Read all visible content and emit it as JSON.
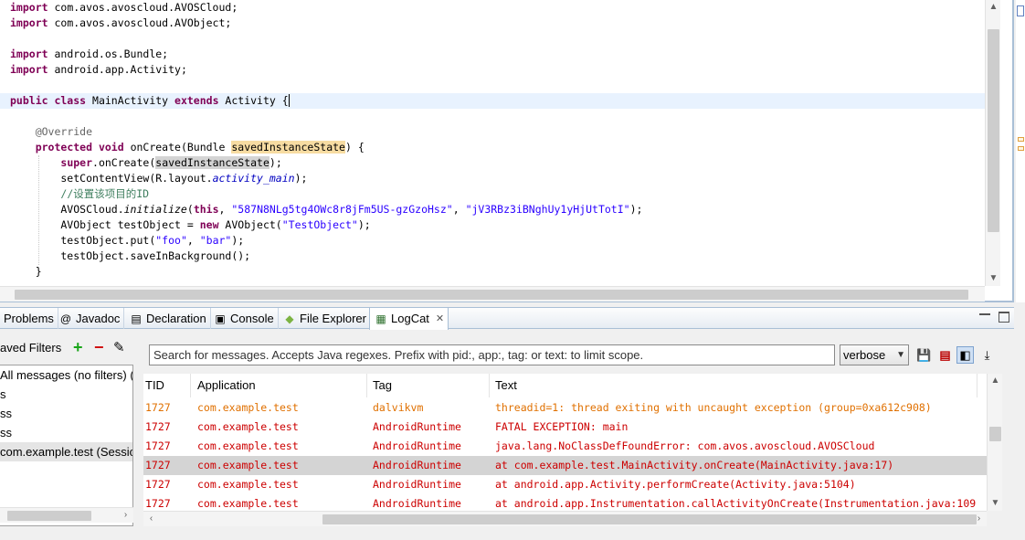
{
  "editor": {
    "lines": [
      {
        "html": "<span class=\"kw\">import</span> com.avos.avoscloud.AVOSCloud;"
      },
      {
        "html": "<span class=\"kw\">import</span> com.avos.avoscloud.AVObject;"
      },
      {
        "html": ""
      },
      {
        "html": "<span class=\"kw\">import</span> android.os.Bundle;"
      },
      {
        "html": "<span class=\"kw\">import</span> android.app.Activity;"
      },
      {
        "html": ""
      },
      {
        "html": "<span class=\"kw\">public class</span> MainActivity <span class=\"kw\">extends</span> Activity {<span class=\"caret\"></span>",
        "current": true
      },
      {
        "html": ""
      },
      {
        "html": "    <span class=\"ann\">@Override</span>"
      },
      {
        "html": "    <span class=\"kw\">protected void</span> onCreate(Bundle <span class=\"hl\">savedInstanceState</span>) {"
      },
      {
        "html": "        <span class=\"kw\">super</span>.onCreate(<span class=\"hl2\">savedInstanceState</span>);"
      },
      {
        "html": "        setContentView(R.layout.<span class=\"it\">activity_main</span>);"
      },
      {
        "html": "        <span class=\"cmt\">//设置该项目的ID</span>"
      },
      {
        "html": "        AVOSCloud.<span class=\"ital\">initialize</span>(<span class=\"kw\">this</span>, <span class=\"str\">\"587N8NLg5tg4OWc8r8jFm5US-gzGzoHsz\"</span>, <span class=\"str\">\"jV3RBz3iBNghUy1yHjUtTotI\"</span>);"
      },
      {
        "html": "        AVObject testObject = <span class=\"kw\">new</span> AVObject(<span class=\"str\">\"TestObject\"</span>);"
      },
      {
        "html": "        testObject.put(<span class=\"str\">\"foo\"</span>, <span class=\"str\">\"bar\"</span>);"
      },
      {
        "html": "        testObject.saveInBackground();"
      },
      {
        "html": "    }"
      }
    ]
  },
  "tabs": [
    {
      "label": "Problems",
      "icon": "problems-icon",
      "glyph": ""
    },
    {
      "label": "Javadoc",
      "icon": "javadoc-icon",
      "glyph": "@"
    },
    {
      "label": "Declaration",
      "icon": "declaration-icon",
      "glyph": "▤"
    },
    {
      "label": "Console",
      "icon": "console-icon",
      "glyph": "▣"
    },
    {
      "label": "File Explorer",
      "icon": "android-icon",
      "glyph": "◆"
    },
    {
      "label": "LogCat",
      "icon": "logcat-icon",
      "glyph": "▦",
      "active": true
    }
  ],
  "logcat": {
    "filters_title": "aved Filters",
    "filters": [
      {
        "label": "All messages (no filters) ("
      },
      {
        "label": "s"
      },
      {
        "label": "ss"
      },
      {
        "label": "ss"
      },
      {
        "label": "com.example.test (Sessio",
        "selected": true
      }
    ],
    "search_placeholder": "Search for messages. Accepts Java regexes. Prefix with pid:, app:, tag: or text: to limit scope.",
    "level": "verbose",
    "columns": {
      "tid": "TID",
      "application": "Application",
      "tag": "Tag",
      "text": "Text"
    },
    "rows": [
      {
        "tid": "1727",
        "app": "com.example.test",
        "tag": "dalvikvm",
        "text": "threadid=1: thread exiting with uncaught exception (group=0xa612c908)",
        "color": "#e07000"
      },
      {
        "tid": "1727",
        "app": "com.example.test",
        "tag": "AndroidRuntime",
        "text": "FATAL EXCEPTION: main",
        "color": "#cc0000"
      },
      {
        "tid": "1727",
        "app": "com.example.test",
        "tag": "AndroidRuntime",
        "text": "java.lang.NoClassDefFoundError: com.avos.avoscloud.AVOSCloud",
        "color": "#cc0000"
      },
      {
        "tid": "1727",
        "app": "com.example.test",
        "tag": "AndroidRuntime",
        "text": "at com.example.test.MainActivity.onCreate(MainActivity.java:17)",
        "color": "#cc0000",
        "selected": true
      },
      {
        "tid": "1727",
        "app": "com.example.test",
        "tag": "AndroidRuntime",
        "text": "at android.app.Activity.performCreate(Activity.java:5104)",
        "color": "#cc0000"
      },
      {
        "tid": "1727",
        "app": "com.example.test",
        "tag": "AndroidRuntime",
        "text": "at android.app.Instrumentation.callActivityOnCreate(Instrumentation.java:109",
        "color": "#cc0000"
      }
    ]
  }
}
